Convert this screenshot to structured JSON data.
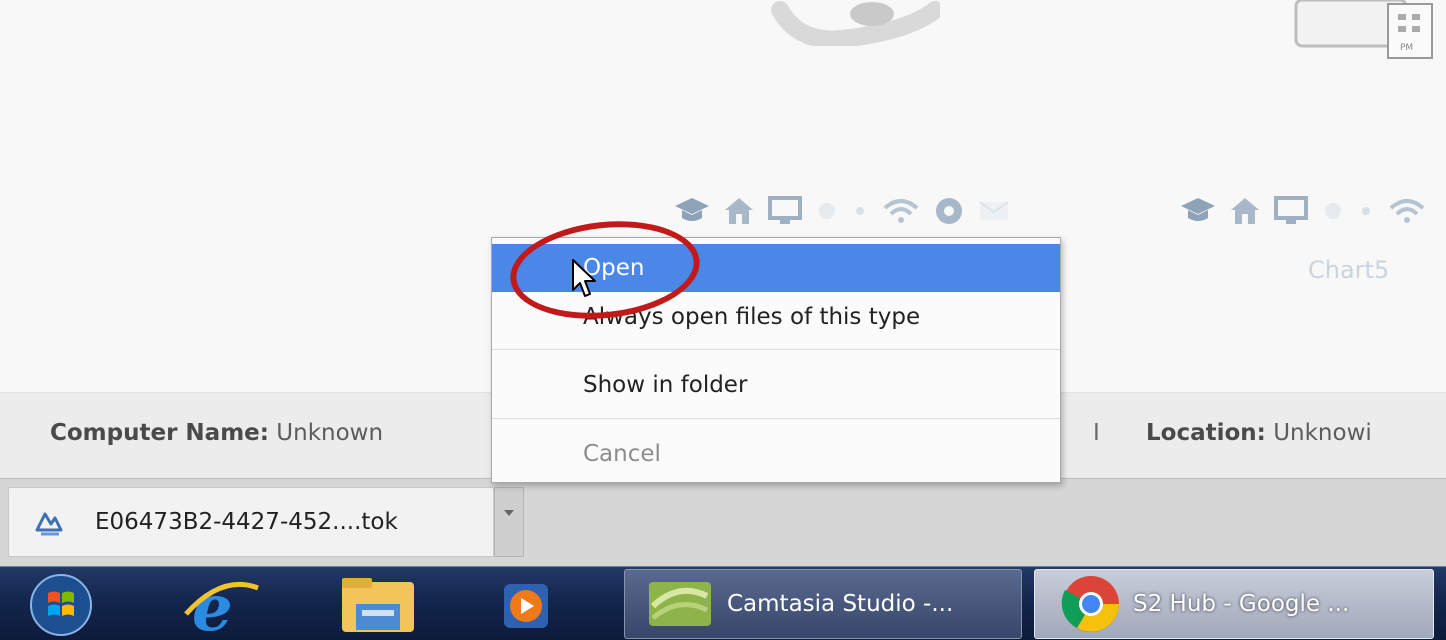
{
  "page": {
    "chart_label": "Chart5",
    "computer_name_label": "Computer Name:",
    "computer_name_value": "Unknown",
    "separator": "I",
    "location_label": "Location:",
    "location_value": "Unknowi"
  },
  "download_bar": {
    "file_name": "E06473B2-4427-452....tok",
    "file_icon": "download-file-icon"
  },
  "context_menu": {
    "items": [
      {
        "label": "Open",
        "state": "highlighted"
      },
      {
        "label": "Always open files of this type",
        "state": "normal"
      },
      {
        "label": "Show in folder",
        "state": "normal"
      },
      {
        "label": "Cancel",
        "state": "disabled"
      }
    ],
    "highlight_color": "#4a87e6",
    "annotation_color": "#c21a1a"
  },
  "taskbar": {
    "pinned": [
      "start-orb-icon",
      "internet-explorer-icon",
      "file-explorer-icon",
      "media-player-icon"
    ],
    "tasks": [
      {
        "label": "Camtasia Studio -...",
        "icon": "camtasia-icon"
      },
      {
        "label": "S2 Hub - Google ...",
        "icon": "chrome-icon"
      }
    ]
  },
  "status_icons": [
    "graduation-cap-icon",
    "home-icon",
    "monitor-icon",
    "dot-icon",
    "dot-icon",
    "wifi-icon",
    "record-icon",
    "envelope-icon"
  ]
}
